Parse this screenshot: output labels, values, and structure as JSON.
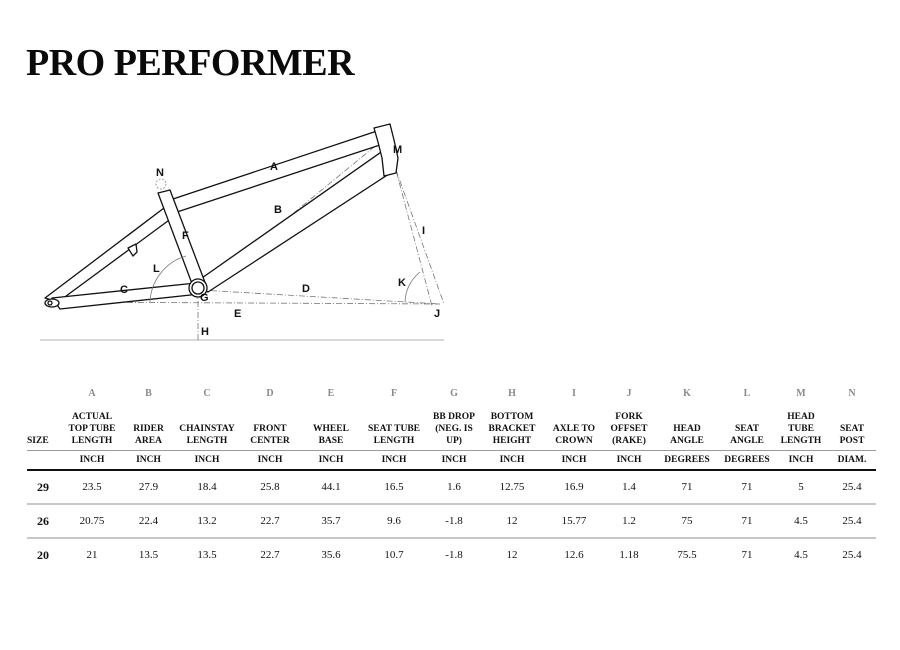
{
  "page": {
    "title": "PRO PERFORMER"
  },
  "diagram": {
    "labels": {
      "A": "A",
      "B": "B",
      "C": "C",
      "D": "D",
      "E": "E",
      "F": "F",
      "G": "G",
      "H": "H",
      "I": "I",
      "J": "J",
      "K": "K",
      "L": "L",
      "M": "M",
      "N": "N"
    }
  },
  "table": {
    "size_header": "SIZE",
    "columns": [
      {
        "letter": "A",
        "name_lines": [
          "ACTUAL",
          "TOP TUBE",
          "LENGTH"
        ],
        "unit": "INCH"
      },
      {
        "letter": "B",
        "name_lines": [
          "RIDER",
          "AREA"
        ],
        "unit": "INCH"
      },
      {
        "letter": "C",
        "name_lines": [
          "CHAINSTAY",
          "LENGTH"
        ],
        "unit": "INCH"
      },
      {
        "letter": "D",
        "name_lines": [
          "FRONT",
          "CENTER"
        ],
        "unit": "INCH"
      },
      {
        "letter": "E",
        "name_lines": [
          "WHEEL",
          "BASE"
        ],
        "unit": "INCH"
      },
      {
        "letter": "F",
        "name_lines": [
          "SEAT TUBE",
          "LENGTH"
        ],
        "unit": "INCH"
      },
      {
        "letter": "G",
        "name_lines": [
          "BB DROP",
          "(NEG. IS",
          "UP)"
        ],
        "unit": "INCH"
      },
      {
        "letter": "H",
        "name_lines": [
          "BOTTOM",
          "BRACKET",
          "HEIGHT"
        ],
        "unit": "INCH"
      },
      {
        "letter": "I",
        "name_lines": [
          "AXLE TO",
          "CROWN"
        ],
        "unit": "INCH"
      },
      {
        "letter": "J",
        "name_lines": [
          "FORK",
          "OFFSET",
          "(RAKE)"
        ],
        "unit": "INCH"
      },
      {
        "letter": "K",
        "name_lines": [
          "HEAD",
          "ANGLE"
        ],
        "unit": "DEGREES"
      },
      {
        "letter": "L",
        "name_lines": [
          "SEAT",
          "ANGLE"
        ],
        "unit": "DEGREES"
      },
      {
        "letter": "M",
        "name_lines": [
          "HEAD",
          "TUBE",
          "LENGTH"
        ],
        "unit": "INCH"
      },
      {
        "letter": "N",
        "name_lines": [
          "SEAT",
          "POST"
        ],
        "unit": "DIAM."
      }
    ],
    "rows": [
      {
        "size": "29",
        "values": [
          "23.5",
          "27.9",
          "18.4",
          "25.8",
          "44.1",
          "16.5",
          "1.6",
          "12.75",
          "16.9",
          "1.4",
          "71",
          "71",
          "5",
          "25.4"
        ]
      },
      {
        "size": "26",
        "values": [
          "20.75",
          "22.4",
          "13.2",
          "22.7",
          "35.7",
          "9.6",
          "-1.8",
          "12",
          "15.77",
          "1.2",
          "75",
          "71",
          "4.5",
          "25.4"
        ]
      },
      {
        "size": "20",
        "values": [
          "21",
          "13.5",
          "13.5",
          "22.7",
          "35.6",
          "10.7",
          "-1.8",
          "12",
          "12.6",
          "1.18",
          "75.5",
          "71",
          "4.5",
          "25.4"
        ]
      }
    ]
  }
}
